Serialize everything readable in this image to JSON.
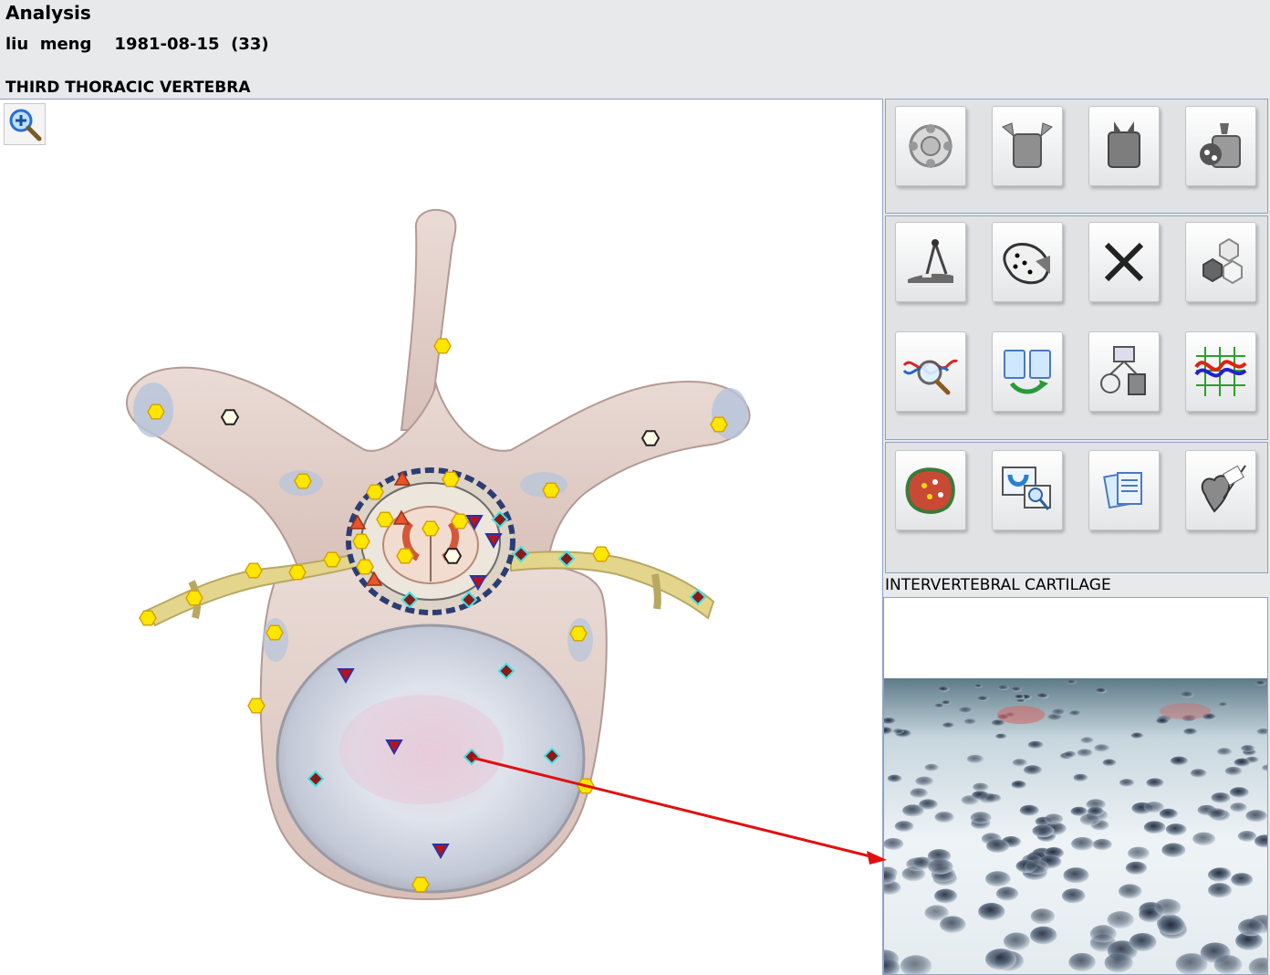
{
  "header": {
    "title": "Analysis",
    "patient_line": "liu  meng    1981-08-15  (33)",
    "section_title": "THIRD THORACIC VERTEBRA"
  },
  "main": {
    "zoom_icon": "zoom-in-magnifier-icon"
  },
  "toolbar": {
    "group1": [
      {
        "icon": "target-crosshair-icon"
      },
      {
        "icon": "organ-expand-icon"
      },
      {
        "icon": "organ-collapse-icon"
      },
      {
        "icon": "tissue-sample-icon"
      }
    ],
    "group2": [
      {
        "icon": "compass-measure-icon"
      },
      {
        "icon": "point-map-icon"
      },
      {
        "icon": "close-x-icon"
      },
      {
        "icon": "hexagon-cells-icon"
      },
      {
        "icon": "wave-search-icon"
      },
      {
        "icon": "clipboard-swap-icon"
      },
      {
        "icon": "process-chart-icon"
      },
      {
        "icon": "spectrum-graph-icon"
      }
    ],
    "group3": [
      {
        "icon": "tissue-map-icon"
      },
      {
        "icon": "window-magnify-icon"
      },
      {
        "icon": "document-pages-icon"
      },
      {
        "icon": "heart-scan-icon"
      }
    ]
  },
  "detail": {
    "label": "INTERVERTEBRAL CARTILAGE"
  },
  "colors": {
    "marker_yellow": "#ffe600",
    "marker_white": "#fffde8",
    "marker_red_triangle": "#b4141e",
    "marker_orange_triangle": "#e8552a",
    "marker_diamond": "#8a1a1a",
    "marker_diamond_border": "#44e0e0",
    "pointer_line": "#e01010"
  }
}
